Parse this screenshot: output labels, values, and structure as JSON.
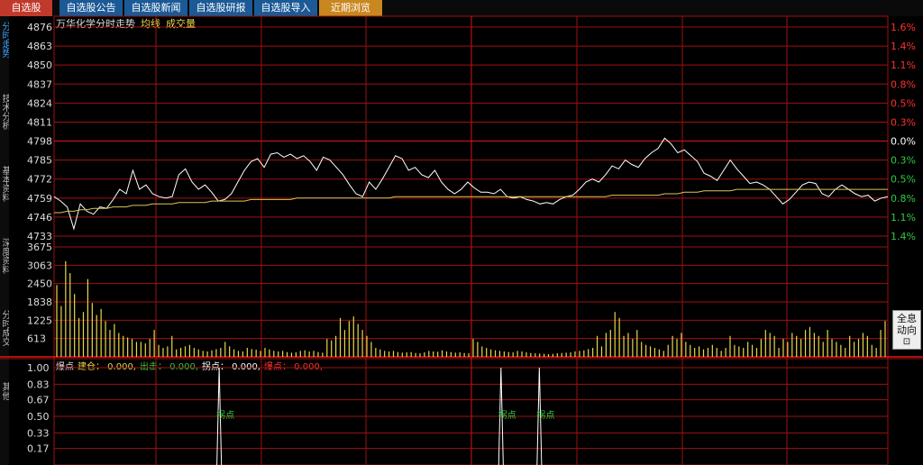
{
  "tabs": [
    {
      "label": "自选股"
    },
    {
      "label": "自选股公告"
    },
    {
      "label": "自选股新闻"
    },
    {
      "label": "自选股研报"
    },
    {
      "label": "自选股导入"
    },
    {
      "label": "近期浏览"
    }
  ],
  "sidebar": [
    {
      "label": "分时走势"
    },
    {
      "label": "技术分析"
    },
    {
      "label": "基本资料"
    },
    {
      "label": "深度资料"
    },
    {
      "label": "分时成交"
    },
    {
      "label": "其他"
    }
  ],
  "title": {
    "stock": "万华化学分时走势",
    "avg_label": "均线",
    "vol_label": "成交量"
  },
  "side_button": {
    "line1": "全息",
    "line2": "动向"
  },
  "indicator": {
    "name": "爆点",
    "items": [
      {
        "label": "建仓",
        "value": "0.000,",
        "color": "#e8d84a"
      },
      {
        "label": "出击",
        "value": "0.000,",
        "color": "#2ecc40"
      },
      {
        "label": "拐点",
        "value": "0.000,",
        "color": "#ffffff"
      },
      {
        "label": "爆点",
        "value": "0.000,",
        "color": "#ff3030"
      }
    ]
  },
  "chart_data": [
    {
      "type": "line",
      "ylim": [
        4733,
        4876
      ],
      "y_ticks": [
        {
          "label": "4876",
          "v": 4876
        },
        {
          "label": "4863",
          "v": 4863
        },
        {
          "label": "4850",
          "v": 4850
        },
        {
          "label": "4837",
          "v": 4837
        },
        {
          "label": "4824",
          "v": 4824
        },
        {
          "label": "4811",
          "v": 4811
        },
        {
          "label": "4798",
          "v": 4798
        },
        {
          "label": "4785",
          "v": 4785
        },
        {
          "label": "4772",
          "v": 4772
        },
        {
          "label": "4759",
          "v": 4759
        },
        {
          "label": "4746",
          "v": 4746
        },
        {
          "label": "4733",
          "v": 4733
        }
      ],
      "right_ticks": [
        {
          "label": "1.6%",
          "v": 4876,
          "color": "#ff3030"
        },
        {
          "label": "1.4%",
          "v": 4863,
          "color": "#ff3030"
        },
        {
          "label": "1.1%",
          "v": 4850,
          "color": "#ff3030"
        },
        {
          "label": "0.8%",
          "v": 4837,
          "color": "#ff3030"
        },
        {
          "label": "0.5%",
          "v": 4824,
          "color": "#ff3030"
        },
        {
          "label": "0.3%",
          "v": 4811,
          "color": "#ff3030"
        },
        {
          "label": "0.0%",
          "v": 4798,
          "color": "#ffffff"
        },
        {
          "label": "0.3%",
          "v": 4785,
          "color": "#2ecc40"
        },
        {
          "label": "0.5%",
          "v": 4772,
          "color": "#2ecc40"
        },
        {
          "label": "0.8%",
          "v": 4759,
          "color": "#2ecc40"
        },
        {
          "label": "1.1%",
          "v": 4746,
          "color": "#2ecc40"
        },
        {
          "label": "1.4%",
          "v": 4733,
          "color": "#2ecc40"
        }
      ],
      "series": [
        {
          "color": "#ffffff",
          "values": [
            4760,
            4757,
            4753,
            4738,
            4755,
            4750,
            4748,
            4753,
            4752,
            4758,
            4765,
            4762,
            4778,
            4765,
            4768,
            4762,
            4760,
            4759,
            4760,
            4775,
            4779,
            4770,
            4765,
            4768,
            4763,
            4757,
            4758,
            4762,
            4770,
            4778,
            4784,
            4786,
            4780,
            4789,
            4790,
            4787,
            4789,
            4786,
            4788,
            4784,
            4778,
            4787,
            4785,
            4780,
            4775,
            4768,
            4762,
            4760,
            4770,
            4765,
            4772,
            4780,
            4788,
            4786,
            4778,
            4780,
            4775,
            4773,
            4778,
            4770,
            4765,
            4762,
            4765,
            4770,
            4766,
            4763,
            4763,
            4762,
            4765,
            4760,
            4759,
            4760,
            4758,
            4757,
            4755,
            4756,
            4755,
            4758,
            4760,
            4761,
            4765,
            4770,
            4772,
            4770,
            4775,
            4781,
            4779,
            4785,
            4782,
            4780,
            4786,
            4790,
            4793,
            4800,
            4796,
            4790,
            4792,
            4788,
            4784,
            4776,
            4774,
            4771,
            4778,
            4785,
            4779,
            4774,
            4769,
            4770,
            4768,
            4765,
            4760,
            4755,
            4758,
            4763,
            4768,
            4770,
            4769,
            4762,
            4760,
            4765,
            4768,
            4765,
            4762,
            4760,
            4761,
            4757,
            4759,
            4760
          ]
        },
        {
          "color": "#d8c85a",
          "values": [
            4749,
            4749,
            4750,
            4750,
            4751,
            4751,
            4752,
            4752,
            4752,
            4753,
            4753,
            4753,
            4754,
            4754,
            4754,
            4755,
            4755,
            4755,
            4755,
            4756,
            4756,
            4756,
            4756,
            4756,
            4757,
            4757,
            4757,
            4757,
            4757,
            4757,
            4758,
            4758,
            4758,
            4758,
            4758,
            4758,
            4758,
            4759,
            4759,
            4759,
            4759,
            4759,
            4759,
            4759,
            4759,
            4759,
            4759,
            4759,
            4759,
            4759,
            4759,
            4759,
            4760,
            4760,
            4760,
            4760,
            4760,
            4760,
            4760,
            4760,
            4760,
            4760,
            4760,
            4760,
            4760,
            4760,
            4760,
            4760,
            4760,
            4760,
            4760,
            4760,
            4760,
            4760,
            4760,
            4760,
            4760,
            4760,
            4760,
            4760,
            4760,
            4760,
            4760,
            4760,
            4760,
            4761,
            4761,
            4761,
            4761,
            4761,
            4761,
            4761,
            4761,
            4762,
            4762,
            4762,
            4763,
            4763,
            4763,
            4764,
            4764,
            4764,
            4764,
            4764,
            4765,
            4765,
            4765,
            4765,
            4765,
            4765,
            4765,
            4765,
            4765,
            4765,
            4765,
            4765,
            4765,
            4765,
            4765,
            4765,
            4765,
            4765,
            4765,
            4765,
            4765,
            4765,
            4765,
            4765
          ]
        }
      ]
    },
    {
      "type": "bar",
      "ylim": [
        0,
        3675
      ],
      "y_ticks": [
        {
          "label": "3675",
          "v": 3675
        },
        {
          "label": "3063",
          "v": 3063
        },
        {
          "label": "2450",
          "v": 2450
        },
        {
          "label": "1838",
          "v": 1838
        },
        {
          "label": "1225",
          "v": 1225
        },
        {
          "label": "613",
          "v": 613
        }
      ],
      "values": [
        2400,
        1700,
        3200,
        2800,
        2100,
        1300,
        1500,
        2600,
        1800,
        1400,
        1600,
        1200,
        900,
        1100,
        800,
        700,
        650,
        600,
        500,
        500,
        450,
        600,
        900,
        400,
        300,
        350,
        700,
        250,
        300,
        350,
        400,
        300,
        250,
        200,
        180,
        220,
        260,
        300,
        500,
        350,
        250,
        200,
        180,
        300,
        260,
        240,
        200,
        300,
        250,
        200,
        180,
        200,
        160,
        140,
        150,
        200,
        220,
        180,
        200,
        160,
        140,
        600,
        550,
        700,
        1300,
        900,
        1200,
        1350,
        1100,
        900,
        700,
        500,
        300,
        250,
        200,
        180,
        200,
        160,
        140,
        150,
        160,
        130,
        120,
        150,
        200,
        180,
        170,
        220,
        180,
        160,
        140,
        150,
        130,
        120,
        600,
        500,
        350,
        300,
        250,
        220,
        200,
        180,
        160,
        150,
        200,
        180,
        150,
        130,
        120,
        110,
        100,
        90,
        100,
        120,
        130,
        140,
        150,
        180,
        200,
        220,
        260,
        300,
        700,
        350,
        800,
        900,
        1500,
        1300,
        700,
        800,
        600,
        900,
        500,
        400,
        350,
        300,
        250,
        200,
        400,
        700,
        600,
        800,
        500,
        400,
        300,
        350,
        250,
        300,
        400,
        300,
        200,
        300,
        700,
        400,
        350,
        300,
        500,
        400,
        300,
        600,
        900,
        800,
        700,
        300,
        600,
        500,
        800,
        700,
        600,
        900,
        1000,
        800,
        700,
        500,
        900,
        600,
        500,
        400,
        300,
        700,
        500,
        600,
        800,
        700,
        400,
        300,
        900,
        1200
      ]
    },
    {
      "type": "line",
      "ylim": [
        0,
        1.0
      ],
      "y_ticks": [
        {
          "label": "1.00",
          "v": 1.0
        },
        {
          "label": "0.83",
          "v": 0.83
        },
        {
          "label": "0.67",
          "v": 0.67
        },
        {
          "label": "0.50",
          "v": 0.5
        },
        {
          "label": "0.33",
          "v": 0.33
        },
        {
          "label": "0.17",
          "v": 0.17
        }
      ],
      "spikes": [
        {
          "at": 0.198,
          "value": 1.0
        },
        {
          "at": 0.536,
          "value": 1.0
        },
        {
          "at": 0.582,
          "value": 1.0
        }
      ],
      "annotations": [
        {
          "text": "拐点",
          "at": 0.198,
          "v": 0.48
        },
        {
          "text": "拐点",
          "at": 0.536,
          "v": 0.48
        },
        {
          "text": "拐点",
          "at": 0.582,
          "v": 0.48
        }
      ]
    }
  ]
}
